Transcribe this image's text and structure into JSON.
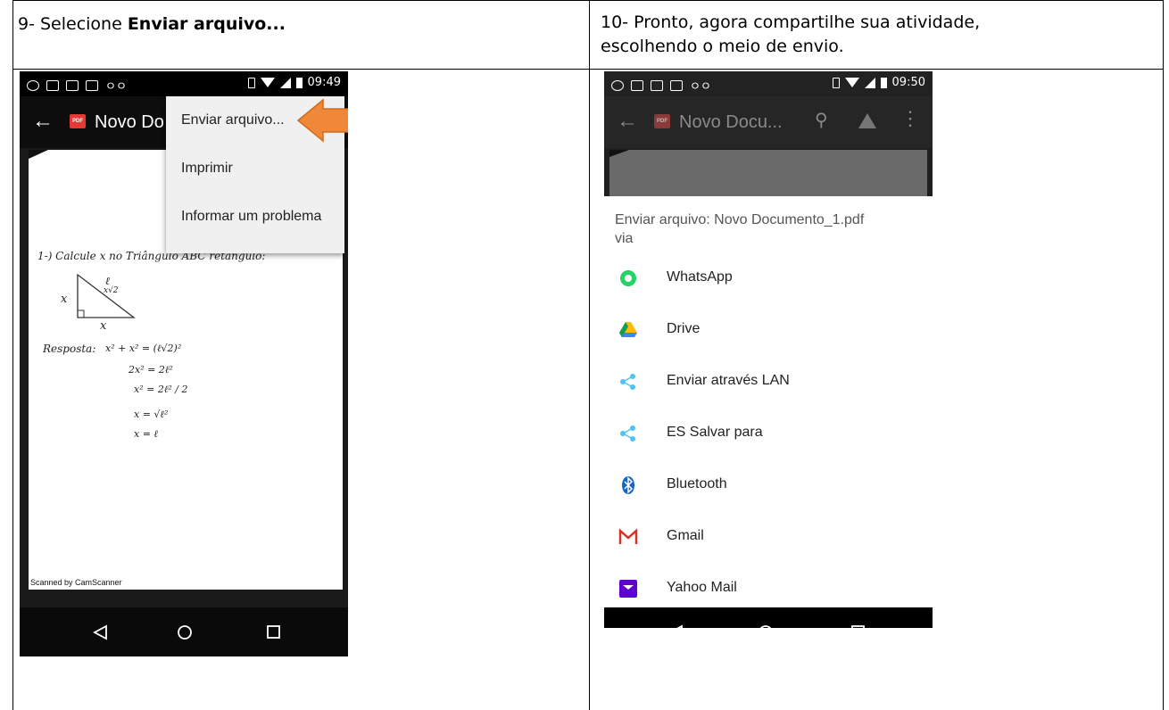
{
  "step9": {
    "text_prefix": "9- Selecione ",
    "text_bold": "Enviar arquivo..."
  },
  "step10": {
    "line1": "10- Pronto, agora compartilhe sua atividade,",
    "line2": "escolhendo o meio de envio."
  },
  "phone1": {
    "status_time": "09:49",
    "doc_title": "Novo Do",
    "pdf_badge": "PDF",
    "menu": [
      "Enviar arquivo...",
      "Imprimir",
      "Informar um problema"
    ],
    "scanned_by": "Scanned by CamScanner",
    "handwriting": {
      "line1": "1-) Calcule x no Triângulo ABC retângulo:",
      "label_l": "ℓ",
      "label_hyp": "x√2",
      "label_x_left": "x",
      "label_x_bottom": "x",
      "resposta": "Resposta:",
      "eq1": "x² + x² = (ℓ√2)²",
      "eq2": "2x² = 2ℓ²",
      "eq3": "x² = 2ℓ² / 2",
      "eq4": "x = √ℓ²",
      "eq5": "x = ℓ"
    }
  },
  "phone2": {
    "status_time": "09:50",
    "doc_title": "Novo Docu...",
    "pdf_badge": "PDF",
    "share_title_line1": "Enviar arquivo: Novo Documento_1.pdf",
    "share_title_line2": "via",
    "apps": [
      {
        "label": "WhatsApp",
        "icon": "whatsapp-icon",
        "color": "#25d366"
      },
      {
        "label": "Drive",
        "icon": "drive-icon",
        "color": "#fbbc04"
      },
      {
        "label": "Enviar através LAN",
        "icon": "share-icon",
        "color": "#4fc3f7"
      },
      {
        "label": "ES Salvar para",
        "icon": "share-icon",
        "color": "#4fc3f7"
      },
      {
        "label": "Bluetooth",
        "icon": "bluetooth-icon",
        "color": "#1565c0"
      },
      {
        "label": "Gmail",
        "icon": "gmail-icon",
        "color": "#d93025"
      },
      {
        "label": "Yahoo Mail",
        "icon": "yahoo-mail-icon",
        "color": "#5f01d1"
      }
    ]
  },
  "colors": {
    "arrow": "#f0883a",
    "pdf_red": "#e53935"
  }
}
